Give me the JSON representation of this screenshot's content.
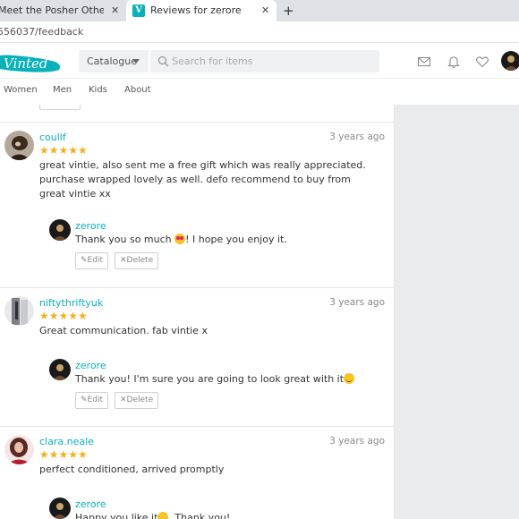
{
  "browser": {
    "tabs": [
      {
        "label": "Meet the Posher Other | Meet Yo",
        "close": "✕"
      },
      {
        "label": "Reviews for zerore",
        "close": "✕",
        "favicon": "V"
      }
    ],
    "new_tab": "+",
    "url": "556037/feedback"
  },
  "header": {
    "logo": "Vinted",
    "catalogue_label": "Catalogue",
    "search_placeholder": "Search for items",
    "icons": [
      "mail-icon",
      "bell-icon",
      "heart-icon",
      "profile-avatar"
    ]
  },
  "nav": {
    "items": [
      "Women",
      "Men",
      "Kids",
      "About"
    ]
  },
  "colors": {
    "accent": "#09b1ba",
    "star": "#f2b01e",
    "sidebar": "#eaebec"
  },
  "reviews": [
    {
      "user": "coullf",
      "time": "3 years ago",
      "stars": "★★★★★",
      "rating": 5,
      "text": "great vintie, also sent me a free gift which was really appreciated. purchase wrapped lovely as well. defo recommend to buy from great vintie xx",
      "reply": {
        "user": "zerore",
        "text_before": "Thank you so much ",
        "text_after": "! I hope you enjoy it.",
        "edit": "Edit",
        "delete": "Delete"
      }
    },
    {
      "user": "niftythriftyuk",
      "time": "3 years ago",
      "stars": "★★★★★",
      "rating": 5,
      "text": "Great communication. fab vintie x",
      "reply": {
        "user": "zerore",
        "text_before": "Thank you! I'm sure you are going to look great with it",
        "text_after": "",
        "edit": "Edit",
        "delete": "Delete"
      }
    },
    {
      "user": "clara.neale",
      "time": "3 years ago",
      "stars": "★★★★★",
      "rating": 5,
      "text": "perfect conditioned, arrived promptly",
      "reply": {
        "user": "zerore",
        "text_before": "Happy you like it",
        "text_after": ". Thank you!"
      }
    }
  ]
}
